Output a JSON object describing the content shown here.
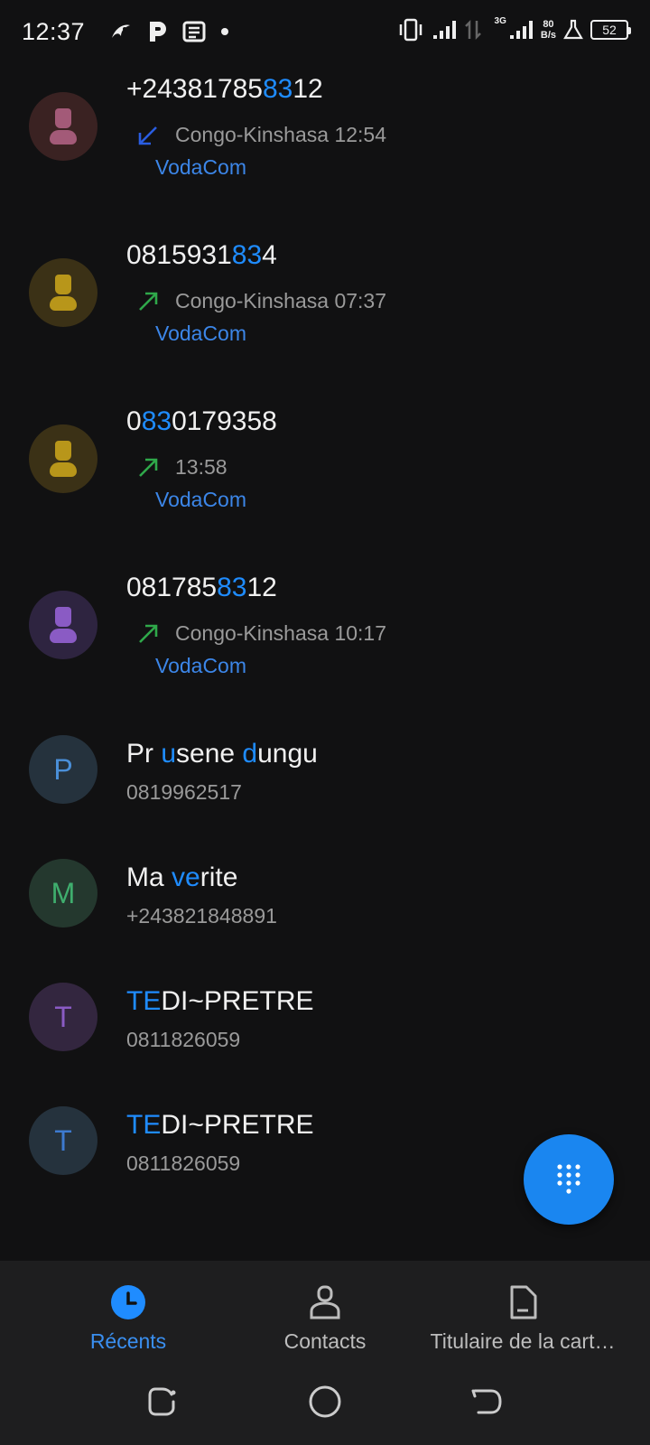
{
  "status_bar": {
    "time": "12:37",
    "left_icons": [
      "bird-app-icon",
      "p-app-icon",
      "news-icon",
      "dot-icon"
    ],
    "net_3g": "3G",
    "net_speed_value": "80",
    "net_speed_unit": "B/s",
    "battery": "52"
  },
  "calls": [
    {
      "name_parts": [
        [
          "+24381785",
          false
        ],
        [
          "83",
          true
        ],
        [
          "12",
          false
        ]
      ],
      "direction": "incoming",
      "detail": "Congo-Kinshasa 12:54",
      "carrier": "VodaCom",
      "avatar_type": "person",
      "avatar_bg": "#3a2222",
      "avatar_fg": "#a35a78"
    },
    {
      "name_parts": [
        [
          "0815931",
          false
        ],
        [
          "83",
          true
        ],
        [
          "4",
          false
        ]
      ],
      "direction": "outgoing",
      "detail": "Congo-Kinshasa 07:37",
      "carrier": "VodaCom",
      "avatar_type": "person",
      "avatar_bg": "#3b3116",
      "avatar_fg": "#b8961a"
    },
    {
      "name_parts": [
        [
          "0",
          false
        ],
        [
          "83",
          true
        ],
        [
          "0179358",
          false
        ]
      ],
      "direction": "outgoing",
      "detail": "13:58",
      "carrier": "VodaCom",
      "avatar_type": "person",
      "avatar_bg": "#3b3116",
      "avatar_fg": "#b8961a"
    },
    {
      "name_parts": [
        [
          "081785",
          false
        ],
        [
          "83",
          true
        ],
        [
          "12",
          false
        ]
      ],
      "direction": "outgoing",
      "detail": "Congo-Kinshasa 10:17",
      "carrier": "VodaCom",
      "avatar_type": "person",
      "avatar_bg": "#2e2440",
      "avatar_fg": "#8a5bc4"
    }
  ],
  "contacts": [
    {
      "name_parts": [
        [
          "Pr ",
          false
        ],
        [
          "u",
          true
        ],
        [
          "sene ",
          false
        ],
        [
          "d",
          true
        ],
        [
          "ungu",
          false
        ]
      ],
      "number": "0819962517",
      "letter": "P",
      "avatar_bg": "#25323d",
      "avatar_fg": "#4a8fd8"
    },
    {
      "name_parts": [
        [
          "Ma ",
          false
        ],
        [
          "ve",
          true
        ],
        [
          "rite",
          false
        ]
      ],
      "number": "+243821848891",
      "letter": "M",
      "avatar_bg": "#24382e",
      "avatar_fg": "#3fae6e"
    },
    {
      "name_parts": [
        [
          "TE",
          true
        ],
        [
          "DI~PRETRE",
          false
        ]
      ],
      "number": "0811826059",
      "letter": "T",
      "avatar_bg": "#33263f",
      "avatar_fg": "#8a5bc4"
    },
    {
      "name_parts": [
        [
          "TE",
          true
        ],
        [
          "DI~PRETRE",
          false
        ]
      ],
      "number": "0811826059",
      "letter": "T",
      "avatar_bg": "#25323d",
      "avatar_fg": "#3d7ad0"
    }
  ],
  "nav": {
    "recents": "Récents",
    "contacts": "Contacts",
    "sim": "Titulaire de la cart…"
  },
  "colors": {
    "accent": "#1f8cff",
    "incoming": "#2a5de0",
    "outgoing": "#2fa84a",
    "carrier": "#3c86e8"
  }
}
